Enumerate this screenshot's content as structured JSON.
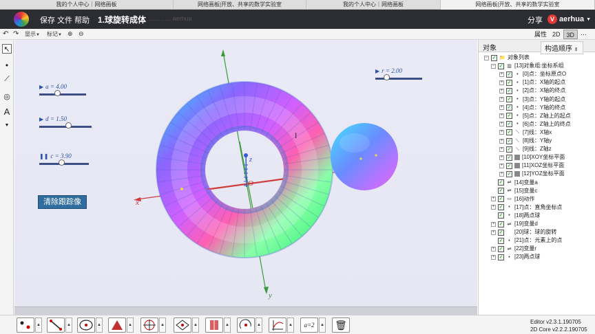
{
  "browser_tabs": [
    "我的个人中心｜网络画板",
    "网络画板|开放、共享的数学实验室",
    "我的个人中心｜网络画板",
    "网络画板|开放、共享的数学实验室"
  ],
  "menu": {
    "save": "保存",
    "file": "文件",
    "help": "帮助"
  },
  "document": {
    "title": "1.球旋转成体",
    "faded_subtitle": "………… aerhua"
  },
  "share": "分享",
  "user": {
    "badge": "V",
    "name": "aerhua"
  },
  "toolbar2": {
    "display": "显示",
    "mark": "标记"
  },
  "view_toggle": {
    "properties": "属性",
    "mode2d": "2D",
    "mode3d": "3D",
    "more": "···"
  },
  "sliders": [
    {
      "name": "a",
      "label": "a = 4.00",
      "play_icon": "▶",
      "value": 4.0
    },
    {
      "name": "d",
      "label": "d = 1.50",
      "play_icon": "▶",
      "value": 1.5
    },
    {
      "name": "c",
      "label": "c = 3.90",
      "play_icon": "❚❚",
      "value": 3.9
    },
    {
      "name": "r",
      "label": "r = 2.00",
      "play_icon": "▶",
      "value": 2.0
    }
  ],
  "clear_trace_button": "清除跟踪像",
  "axes": {
    "x": "x",
    "y": "y",
    "z": "z",
    "origin": "O"
  },
  "right_panel": {
    "title": "对象",
    "order": "构造顺序",
    "tree": [
      {
        "text": "对象列表",
        "level": 0
      },
      {
        "text": "[13]对象组:坐标系组",
        "level": 1
      },
      {
        "text": "[0]点：坐标原点O",
        "level": 2
      },
      {
        "text": "[1]点：X轴的起点",
        "level": 2
      },
      {
        "text": "[2]点：X轴的终点",
        "level": 2
      },
      {
        "text": "[3]点：Y轴的起点",
        "level": 2
      },
      {
        "text": "[4]点：Y轴的终点",
        "level": 2
      },
      {
        "text": "[5]点：Z轴上的起点",
        "level": 2
      },
      {
        "text": "[6]点：Z轴上的终点",
        "level": 2
      },
      {
        "text": "[7]线：X轴x",
        "level": 2
      },
      {
        "text": "[8]线：Y轴y",
        "level": 2
      },
      {
        "text": "[9]线：Z轴z",
        "level": 2
      },
      {
        "text": "[10]XOY坐标平面",
        "level": 2
      },
      {
        "text": "[11]XOZ坐标平面",
        "level": 2
      },
      {
        "text": "[12]YOZ坐标平面",
        "level": 2
      },
      {
        "text": "[14]变量a",
        "level": 1
      },
      {
        "text": "[15]变量c",
        "level": 1
      },
      {
        "text": "[16]动作",
        "level": 1
      },
      {
        "text": "[17]点：直角坐标点",
        "level": 1
      },
      {
        "text": "[18]两点球",
        "level": 1
      },
      {
        "text": "[19]变量d",
        "level": 1
      },
      {
        "text": "[20]球：球的旋转",
        "level": 1
      },
      {
        "text": "[21]点：元素上的点",
        "level": 1
      },
      {
        "text": "[22]变量r",
        "level": 1
      },
      {
        "text": "[23]两点球",
        "level": 1
      }
    ]
  },
  "bottom_tool_label": "a=2",
  "version": {
    "editor": "Editor v2.3.1.190705",
    "core": "2D Core v2.2.2.190705"
  }
}
